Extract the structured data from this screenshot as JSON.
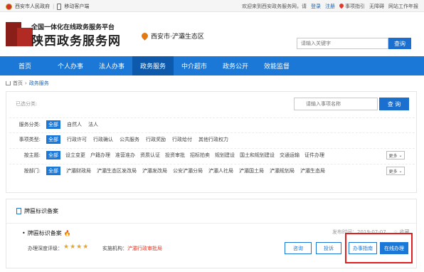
{
  "topbar": {
    "gov_site": "西安市人民政府",
    "mobile": "移动客户端",
    "welcome": "欢迎来到西安政务服务网，请",
    "login": "登录",
    "register": "注册",
    "guide": "事项指引",
    "accessible": "无障碍",
    "workbench": "网站工作年报"
  },
  "header": {
    "slogan": "全国一体化在线政务服务平台",
    "site_name": "陕西政务服务网",
    "location": "西安市·浐灞生态区",
    "search_placeholder": "请输入关键字",
    "search_button": "查询"
  },
  "nav": {
    "items": [
      "首页",
      "个人办事",
      "法人办事",
      "政务服务",
      "中介超市",
      "政务公开",
      "效能监督"
    ],
    "active_index": 3
  },
  "breadcrumb": {
    "home": "首页",
    "current": "政务服务"
  },
  "filters": {
    "selected_label": "已选分类:",
    "search_placeholder": "请输入事项名称",
    "search_button": "查 询",
    "more_label": "更多",
    "rows": [
      {
        "label": "服务分类:",
        "options": [
          "全部",
          "自然人",
          "法人"
        ]
      },
      {
        "label": "事项类型:",
        "options": [
          "全部",
          "行政许可",
          "行政确认",
          "公共服务",
          "行政奖励",
          "行政给付",
          "其他行政权力"
        ]
      },
      {
        "label": "按主题:",
        "options": [
          "全部",
          "设立变更",
          "户籍办理",
          "准营准办",
          "资质认证",
          "投资审批",
          "招标拍卖",
          "规划建设",
          "国土和规划建设",
          "交通运输",
          "证件办理"
        ]
      },
      {
        "label": "按部门:",
        "options": [
          "全部",
          "浐灞财政局",
          "浐灞生态区发改局",
          "浐灞发改局",
          "公安浐灞分局",
          "浐灞人社局",
          "浐灞国土局",
          "浐灞规划局",
          "浐灞生态局"
        ]
      }
    ]
  },
  "result": {
    "section_title": "牌匾标识备案",
    "item_title": "牌匾标识备案",
    "publish_date": "发布时间：2019-07-07",
    "favorite": "收藏",
    "depth_label": "办理深度评级：",
    "stars": "★★★★",
    "agency_label": "实施机构：",
    "agency": "浐灞行政审批局",
    "buttons": {
      "consult": "咨询",
      "complain": "投诉",
      "guide": "办事指南",
      "online": "在线办理"
    }
  },
  "colors": {
    "primary": "#1b78d6",
    "nav_active": "#0d5aac",
    "highlight_box": "#e02020",
    "star": "#f0a31c",
    "agency": "#d93b2b"
  }
}
